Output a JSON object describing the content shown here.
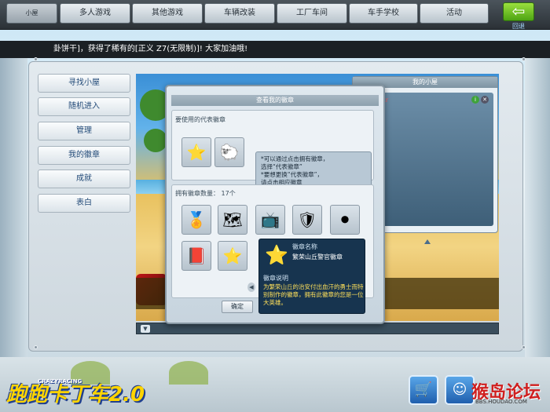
{
  "nav": {
    "current": "小屋",
    "tabs": [
      "多人游戏",
      "其他游戏",
      "车辆改装",
      "工厂车间",
      "车手学校",
      "活动"
    ],
    "back_label": "回退"
  },
  "ticker": "卦饼干]，获得了稀有的[正义 Z7(无限制)]! 大家加油哦!",
  "sidebar": [
    "寻找小屋",
    "随机进入",
    "管理",
    "我的徽章",
    "成就",
    "表白"
  ],
  "my_house": {
    "title": "我的小屋",
    "name_fragment": "ikr"
  },
  "dialog": {
    "title": "查看我的徽章",
    "rep_label": "要使用的代表徽章",
    "tip_lines": [
      "*可以通过点击拥有徽章，",
      "选择“代表徽章”",
      "*要想更换“代表徽章”，",
      "请点击相应徽章"
    ],
    "owned_label": "拥有徽章数量： 17个",
    "ok_label": "确定"
  },
  "detail": {
    "name_label": "徽章名称",
    "name_value": "繁荣山丘警官徽章",
    "desc_label": "徽章说明",
    "desc": "为繁荣山丘的治安付出血汗的勇士而特别制作的徽章，拥有此徽章的您是一位大英雄。"
  },
  "logo": {
    "text": "跑跑卡丁车2.0",
    "sub": "CRAZYRACING"
  },
  "watermark": {
    "text": "猴岛论坛",
    "url": "BBS.HOUDAO.COM"
  },
  "icons": [
    "badge-sheriff-star-icon",
    "badge-sheep-icon",
    "badge-trophy-icon",
    "badge-map-icon",
    "badge-tv-icon",
    "badge-shield-icon",
    "badge-ring-icon",
    "badge-book-icon"
  ]
}
